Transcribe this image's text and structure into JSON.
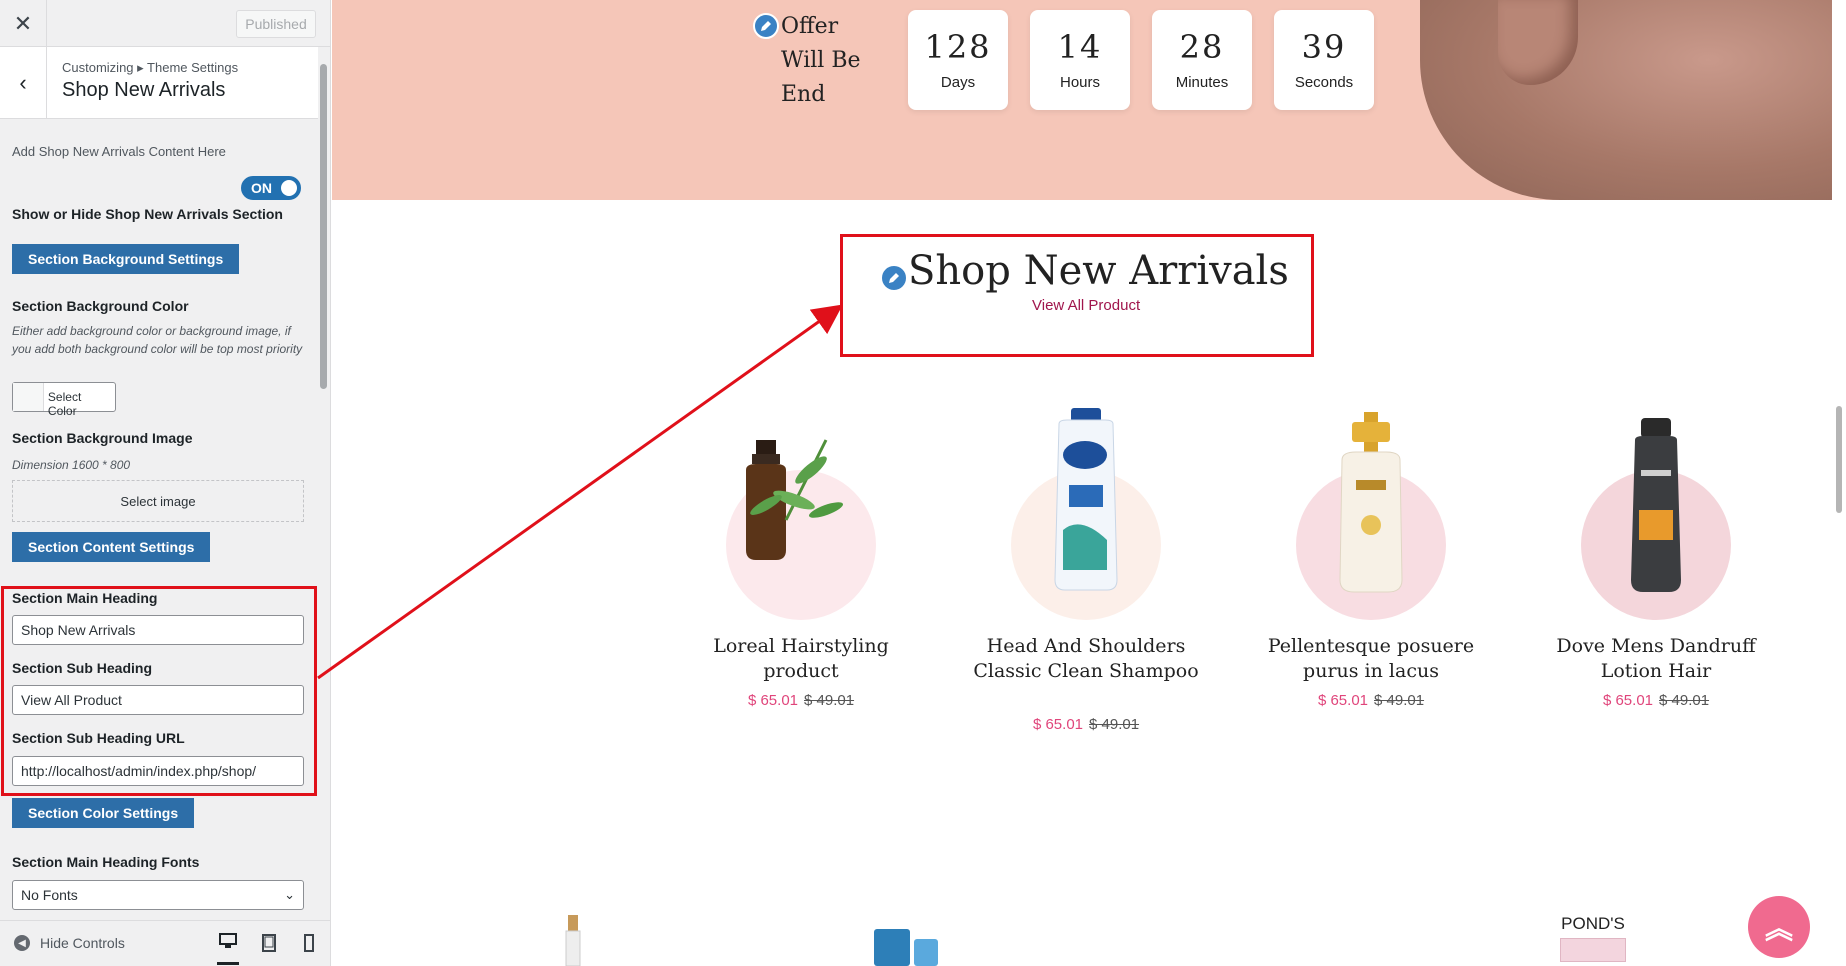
{
  "customizer": {
    "published_label": "Published",
    "breadcrumb": "Customizing ▸ Theme Settings",
    "section_title": "Shop New Arrivals",
    "add_content_desc": "Add Shop New Arrivals Content Here",
    "toggle_label": "ON",
    "show_hide_label": "Show or Hide Shop New Arrivals Section",
    "bg_settings_btn": "Section Background Settings",
    "bg_color_label": "Section Background Color",
    "bg_color_desc": "Either add background color or background image, if you add both background color will be top most priority",
    "select_color": "Select Color",
    "bg_image_label": "Section Background Image",
    "bg_image_dim": "Dimension 1600 * 800",
    "select_image": "Select image",
    "content_settings_btn": "Section Content Settings",
    "main_heading_label": "Section Main Heading",
    "main_heading_value": "Shop New Arrivals",
    "sub_heading_label": "Section Sub Heading",
    "sub_heading_value": "View All Product",
    "sub_heading_url_label": "Section Sub Heading URL",
    "sub_heading_url_value": "http://localhost/admin/index.php/shop/",
    "color_settings_btn": "Section Color Settings",
    "heading_fonts_label": "Section Main Heading Fonts",
    "heading_fonts_value": "No Fonts",
    "hide_controls": "Hide Controls"
  },
  "preview": {
    "offer_text": "Offer Will Be End",
    "countdown": [
      {
        "value": "128",
        "unit": "Days"
      },
      {
        "value": "14",
        "unit": "Hours"
      },
      {
        "value": "28",
        "unit": "Minutes"
      },
      {
        "value": "39",
        "unit": "Seconds"
      }
    ],
    "section_heading": "Shop New Arrivals",
    "section_subheading": "View All Product",
    "products": [
      {
        "name": "Loreal Hairstyling product",
        "price": "$ 65.01",
        "old_price": "$ 49.01"
      },
      {
        "name": "Head And Shoulders Classic Clean Shampoo",
        "price": "$ 65.01",
        "old_price": "$ 49.01"
      },
      {
        "name": "Pellentesque posuere purus in lacus",
        "price": "$ 65.01",
        "old_price": "$ 49.01"
      },
      {
        "name": "Dove Mens Dandruff Lotion Hair",
        "price": "$ 65.01",
        "old_price": "$ 49.01"
      }
    ],
    "bottom_brand": "POND'S",
    "colors": {
      "accent_red": "#e0101a",
      "price_pink": "#e0457b",
      "subheading_magenta": "#a0154c",
      "banner_peach": "#f5c6b8",
      "button_blue": "#2d6ea8"
    }
  }
}
